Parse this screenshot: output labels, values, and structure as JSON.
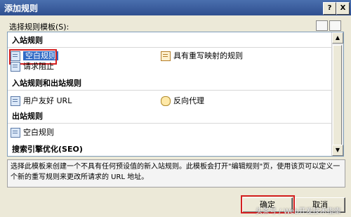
{
  "window": {
    "title": "添加规则",
    "help_label": "?",
    "close_label": "X"
  },
  "template_section": {
    "label": "选择规则模板(S):"
  },
  "groups": [
    {
      "header": "入站规则",
      "items": [
        {
          "label": "空白规则",
          "icon": "blank-rule-icon",
          "selected": true
        },
        {
          "label": "具有重写映射的规则",
          "icon": "rewrite-map-icon"
        },
        {
          "label": "请求阻止",
          "icon": "request-block-icon"
        }
      ]
    },
    {
      "header": "入站规则和出站规则",
      "items": [
        {
          "label": "用户友好 URL",
          "icon": "friendly-url-icon"
        },
        {
          "label": "反向代理",
          "icon": "reverse-proxy-icon"
        }
      ]
    },
    {
      "header": "出站规则",
      "items": [
        {
          "label": "空白规则",
          "icon": "blank-rule-icon"
        }
      ]
    },
    {
      "header": "搜索引擎优化(SEO)",
      "items": []
    }
  ],
  "description": "选择此模板来创建一个不具有任何预设值的新入站规则。此模板会打开\"编辑规则\"页，使用该页可以定义一个新的重写规则来更改所请求的 URL 地址。",
  "buttons": {
    "ok": "确定",
    "cancel": "取消"
  },
  "watermark": "头条号 / Web开发技术指南",
  "colors": {
    "titlebar": "#3b5fa0",
    "highlight": "#d42020",
    "selection": "#316ac5"
  }
}
